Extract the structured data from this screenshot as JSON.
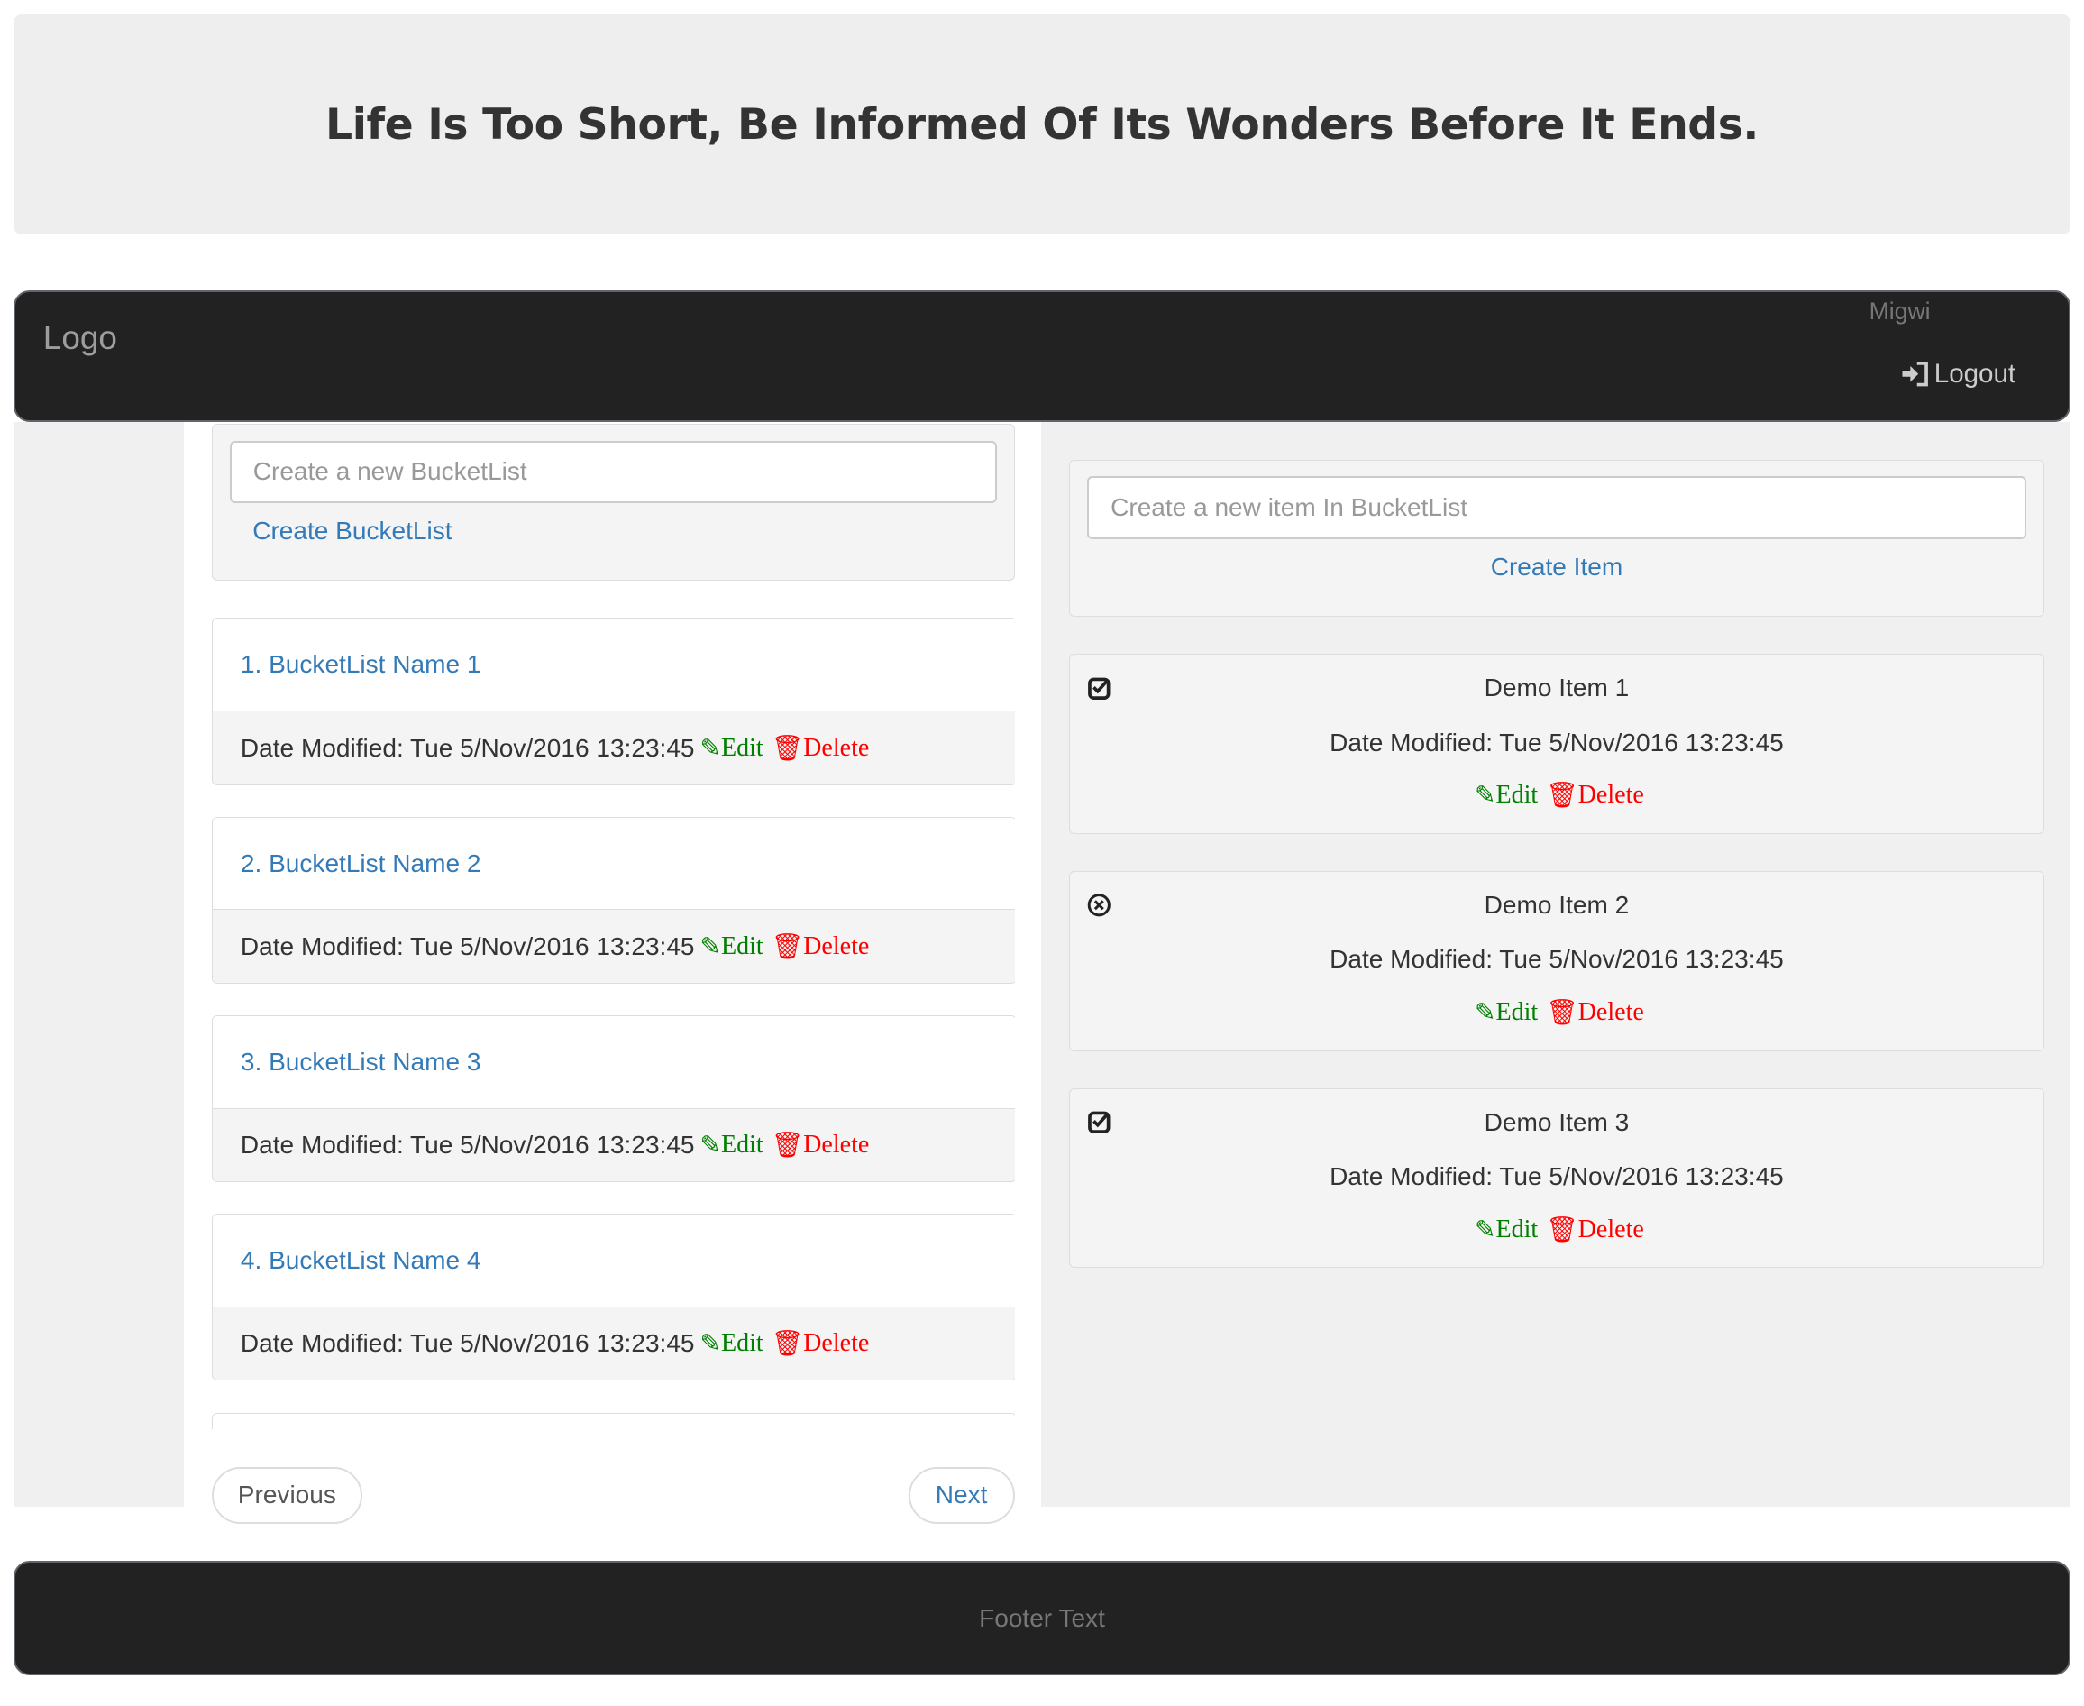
{
  "banner": {
    "title": "Life Is Too Short, Be Informed Of Its Wonders Before It Ends."
  },
  "navbar": {
    "logo": "Logo",
    "username": "Migwi",
    "logout_label": "Logout"
  },
  "left": {
    "create_placeholder": "Create a new BucketList",
    "create_label": "Create BucketList",
    "bucketlists": [
      {
        "name": "1. BucketList Name 1",
        "date": "Date Modified: Tue 5/Nov/2016 13:23:45"
      },
      {
        "name": "2. BucketList Name 2",
        "date": "Date Modified: Tue 5/Nov/2016 13:23:45"
      },
      {
        "name": "3. BucketList Name 3",
        "date": "Date Modified: Tue 5/Nov/2016 13:23:45"
      },
      {
        "name": "4. BucketList Name 4",
        "date": "Date Modified: Tue 5/Nov/2016 13:23:45"
      }
    ],
    "edit_label": "Edit",
    "delete_label": "Delete",
    "previous_label": "Previous",
    "next_label": "Next"
  },
  "right": {
    "create_placeholder": "Create a new item In BucketList",
    "create_label": "Create Item",
    "items": [
      {
        "name": "Demo Item 1",
        "date": "Date Modified: Tue 5/Nov/2016 13:23:45",
        "status_icon": "check-square-icon"
      },
      {
        "name": "Demo Item 2",
        "date": "Date Modified: Tue 5/Nov/2016 13:23:45",
        "status_icon": "times-circle-icon"
      },
      {
        "name": "Demo Item 3",
        "date": "Date Modified: Tue 5/Nov/2016 13:23:45",
        "status_icon": "check-square-icon"
      }
    ],
    "edit_label": "Edit",
    "delete_label": "Delete"
  },
  "footer": {
    "text": "Footer Text"
  },
  "colors": {
    "link": "#337ab7",
    "edit": "#008000",
    "delete": "#ff0000",
    "navbar": "#222222"
  }
}
